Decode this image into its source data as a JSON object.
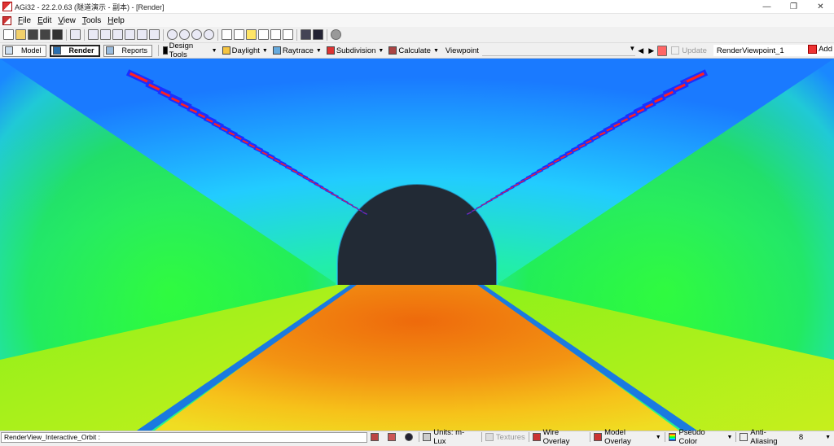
{
  "window": {
    "title": "AGi32 - 22.2.0.63 (隧道演示 - 副本) - [Render]",
    "controls": [
      "—",
      "❐",
      "✕"
    ]
  },
  "menu": {
    "items": [
      {
        "key": "F",
        "rest": "ile"
      },
      {
        "key": "E",
        "rest": "dit"
      },
      {
        "key": "V",
        "rest": "iew"
      },
      {
        "key": "T",
        "rest": "ools"
      },
      {
        "key": "H",
        "rest": "elp"
      }
    ]
  },
  "modes": {
    "model": "Model",
    "render": "Render",
    "reports": "Reports"
  },
  "render_toolbar": {
    "design_tools": "Design Tools",
    "daylight": "Daylight",
    "raytrace": "Raytrace",
    "subdivision": "Subdivision",
    "calculate": "Calculate",
    "viewpoint_label": "Viewpoint",
    "update": "Update",
    "viewpoint_name": "RenderViewpoint_1",
    "add": "Add"
  },
  "status": {
    "mode_text": "RenderView_Interactive_Orbit :",
    "units": "Units: m- Lux",
    "textures": "Textures",
    "wire_overlay": "Wire Overlay",
    "model_overlay": "Model Overlay",
    "pseudo_color": "Pseudo Color",
    "anti_aliasing": "Anti-Aliasing",
    "aa_value": "8"
  },
  "colors": {
    "tunnel_arch": "#222a35",
    "road_center": "#ee7c0c",
    "lane_lines": "#1a7ae0",
    "wall_green": "#33ff22",
    "ceiling_cyan": "#22ddff",
    "luminaire_red": "#ff2020",
    "luminaire_blue": "#1a30ff"
  }
}
